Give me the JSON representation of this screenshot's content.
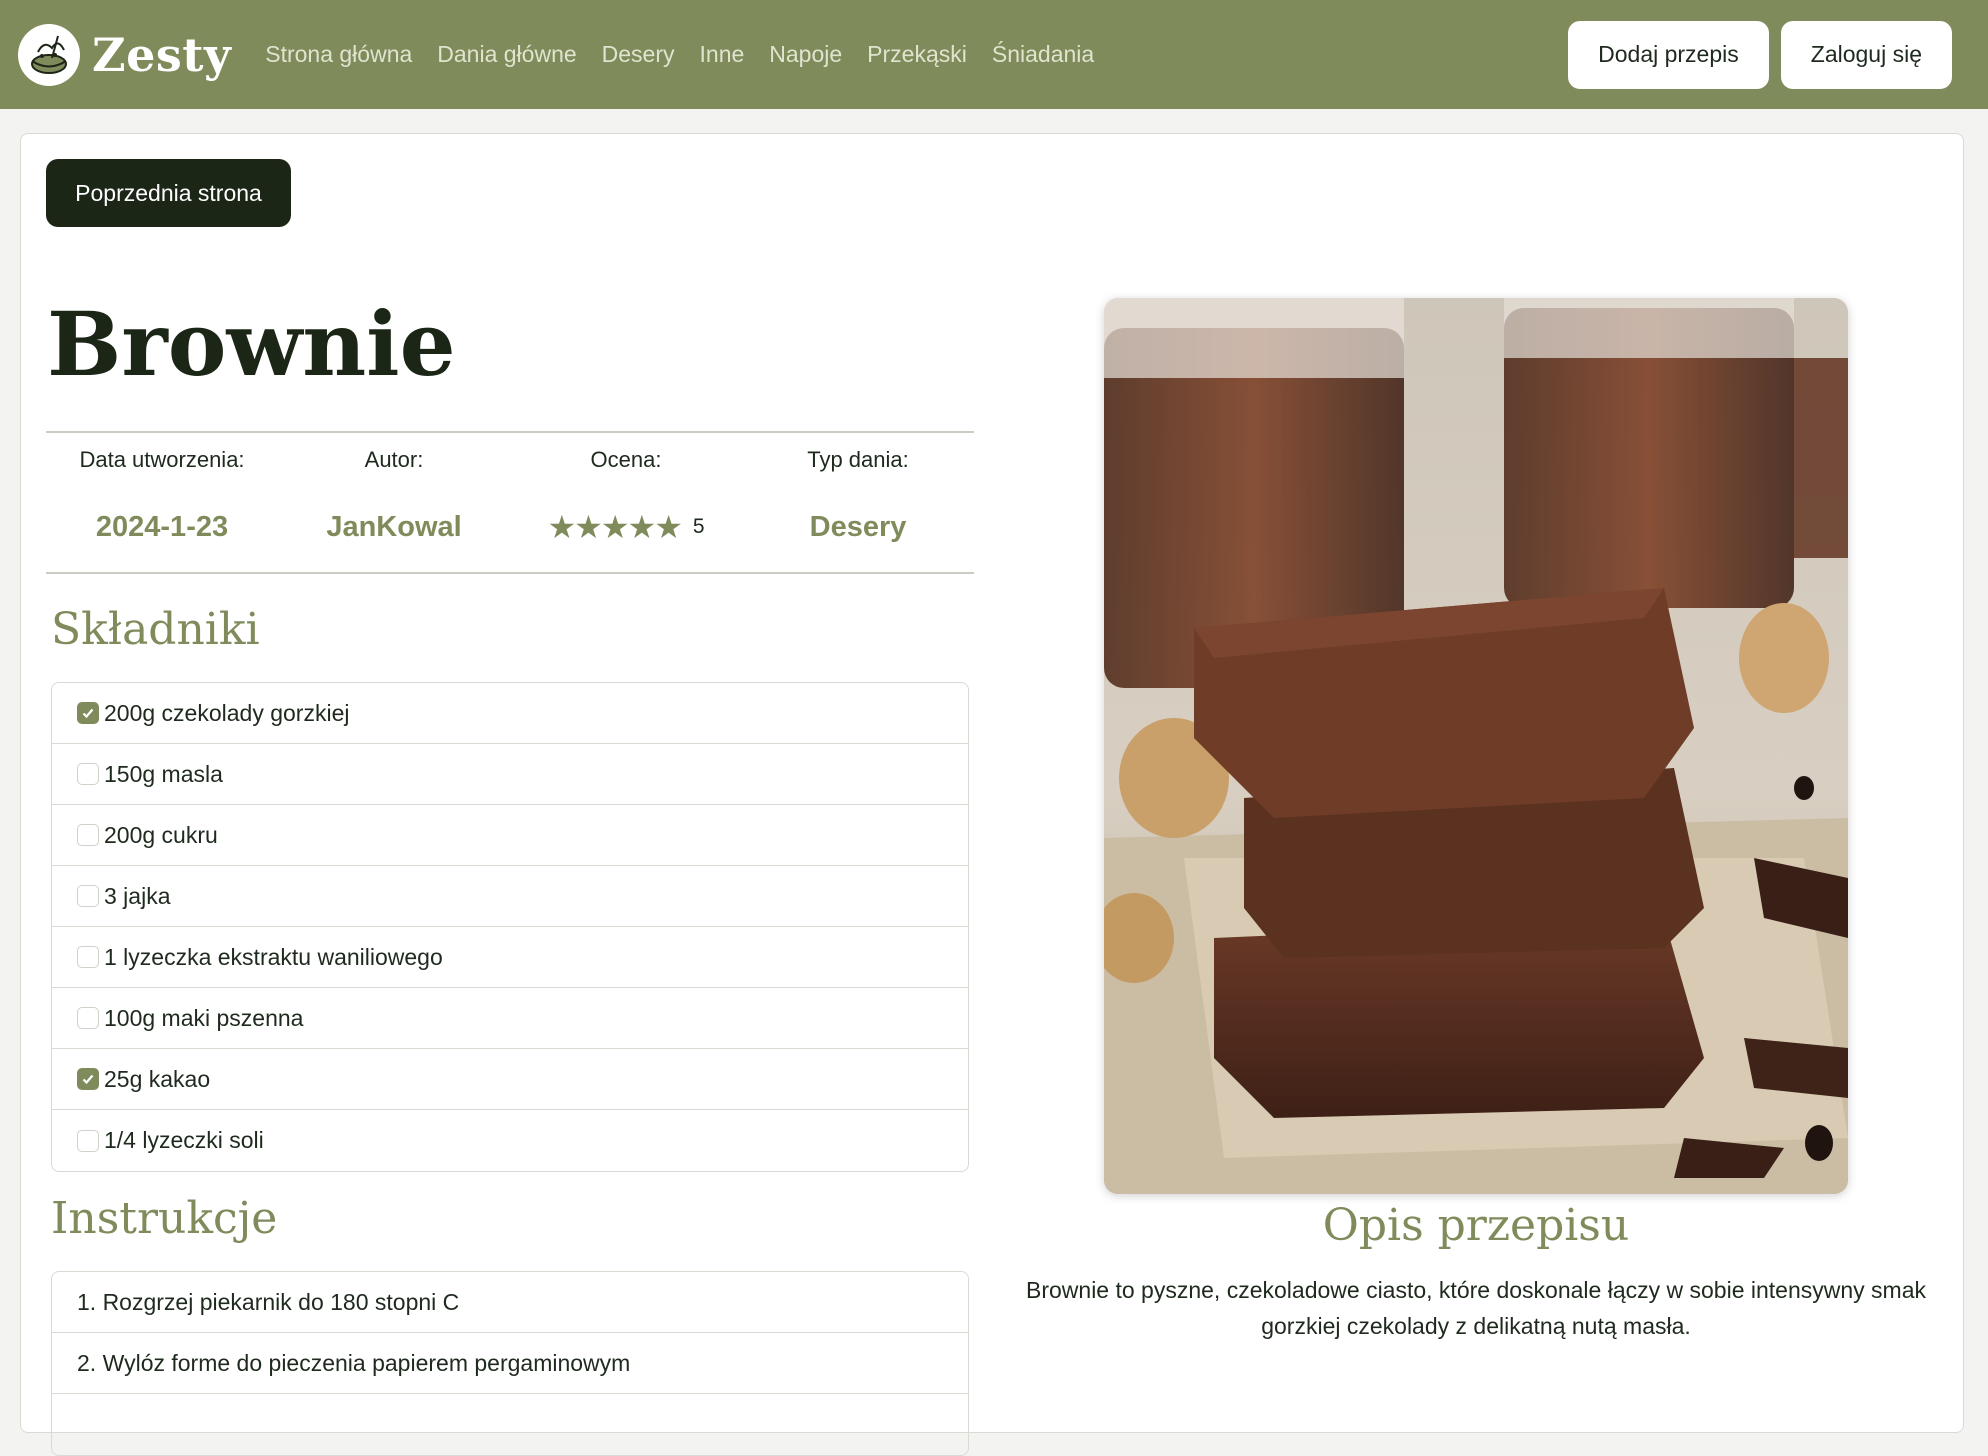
{
  "brand": {
    "name": "Zesty",
    "logo_icon": "chef-bowl-icon"
  },
  "nav": {
    "links": [
      "Strona główna",
      "Dania główne",
      "Desery",
      "Inne",
      "Napoje",
      "Przekąski",
      "Śniadania"
    ],
    "add_recipe": "Dodaj przepis",
    "login": "Zaloguj się"
  },
  "back_button": "Poprzednia strona",
  "recipe": {
    "title": "Brownie",
    "meta": {
      "date_label": "Data utworzenia:",
      "date_value": "2024-1-23",
      "author_label": "Autor:",
      "author_value": "JanKowal",
      "rating_label": "Ocena:",
      "rating_value": "5",
      "rating_stars": 5,
      "type_label": "Typ dania:",
      "type_value": "Desery"
    },
    "ingredients_title": "Składniki",
    "ingredients": [
      {
        "text": "200g czekolady gorzkiej",
        "checked": true
      },
      {
        "text": "150g masla",
        "checked": false
      },
      {
        "text": "200g cukru",
        "checked": false
      },
      {
        "text": "3 jajka",
        "checked": false
      },
      {
        "text": "1 lyzeczka ekstraktu waniliowego",
        "checked": false
      },
      {
        "text": "100g maki pszenna",
        "checked": false
      },
      {
        "text": "25g kakao",
        "checked": true
      },
      {
        "text": "1/4 lyzeczki soli",
        "checked": false
      }
    ],
    "instructions_title": "Instrukcje",
    "instructions": [
      "1. Rozgrzej piekarnik do 180 stopni C",
      "2. Wylóz forme do pieczenia papierem pergaminowym"
    ],
    "description_title": "Opis przepisu",
    "description": "Brownie to pyszne, czekoladowe ciasto, które doskonale łączy w sobie intensywny smak gorzkiej czekolady z delikatną nutą masła."
  },
  "colors": {
    "navbar": "#7f8b5b",
    "accent": "#7f8b5b",
    "dark_button": "#1c2617",
    "page_bg": "#f3f4f1"
  }
}
